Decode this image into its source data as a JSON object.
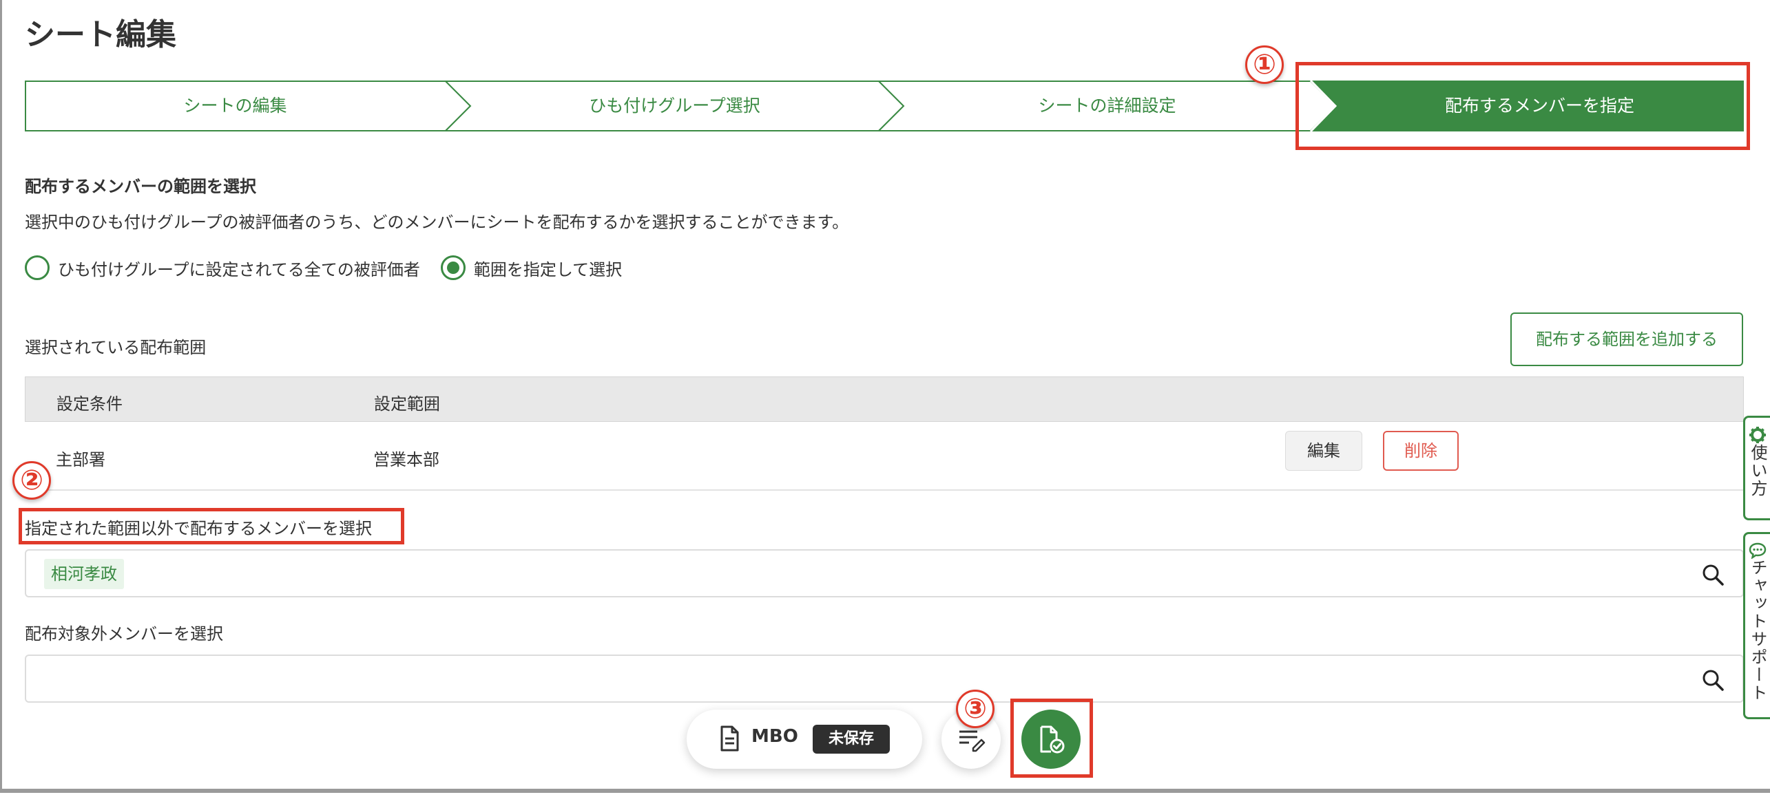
{
  "page": {
    "title": "シート編集"
  },
  "stepper": {
    "steps": [
      {
        "label": "シートの編集"
      },
      {
        "label": "ひも付けグループ選択"
      },
      {
        "label": "シートの詳細設定"
      },
      {
        "label": "配布するメンバーを指定"
      }
    ],
    "active_index": 3
  },
  "annotations": {
    "one": "①",
    "two": "②",
    "three": "③"
  },
  "range_section": {
    "heading": "配布するメンバーの範囲を選択",
    "description": "選択中のひも付けグループの被評価者のうち、どのメンバーにシートを配布するかを選択することができます。",
    "options": [
      {
        "label": "ひも付けグループに設定されてる全ての被評価者",
        "checked": false
      },
      {
        "label": "範囲を指定して選択",
        "checked": true
      }
    ]
  },
  "selected_ranges": {
    "label": "選択されている配布範囲",
    "add_button": "配布する範囲を追加する",
    "columns": [
      "設定条件",
      "設定範囲"
    ],
    "rows": [
      {
        "condition": "主部署",
        "range": "営業本部",
        "edit": "編集",
        "delete": "削除"
      }
    ]
  },
  "extra_members": {
    "label": "指定された範囲以外で配布するメンバーを選択",
    "chips": [
      "相河孝政"
    ]
  },
  "excluded_members": {
    "label": "配布対象外メンバーを選択",
    "value": ""
  },
  "side_tabs": {
    "help": "使い方",
    "chat": "チャットサポート"
  },
  "bottom_bar": {
    "doc_name": "MBO",
    "status_badge": "未保存"
  },
  "colors": {
    "accent": "#3a8a43",
    "danger": "#e05a4f",
    "highlight": "#e03a2a"
  }
}
